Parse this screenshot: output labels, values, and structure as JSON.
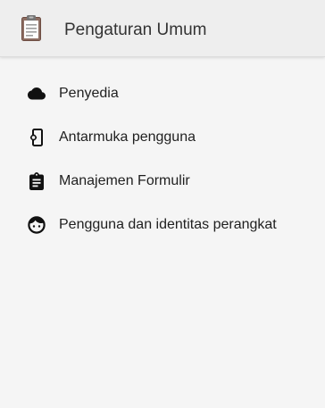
{
  "header": {
    "title": "Pengaturan Umum",
    "icon": "clipboard-icon"
  },
  "menu": {
    "items": [
      {
        "label": "Penyedia",
        "icon": "cloud-icon"
      },
      {
        "label": "Antarmuka pengguna",
        "icon": "phone-settings-icon"
      },
      {
        "label": "Manajemen Formulir",
        "icon": "clipboard-list-icon"
      },
      {
        "label": "Pengguna dan identitas perangkat",
        "icon": "face-icon"
      }
    ]
  },
  "colors": {
    "header_background": "#eeeeee",
    "page_background": "#f5f5f5",
    "text": "#212121",
    "clipboard_board": "#8d6e63",
    "clipboard_clip": "#757575"
  }
}
